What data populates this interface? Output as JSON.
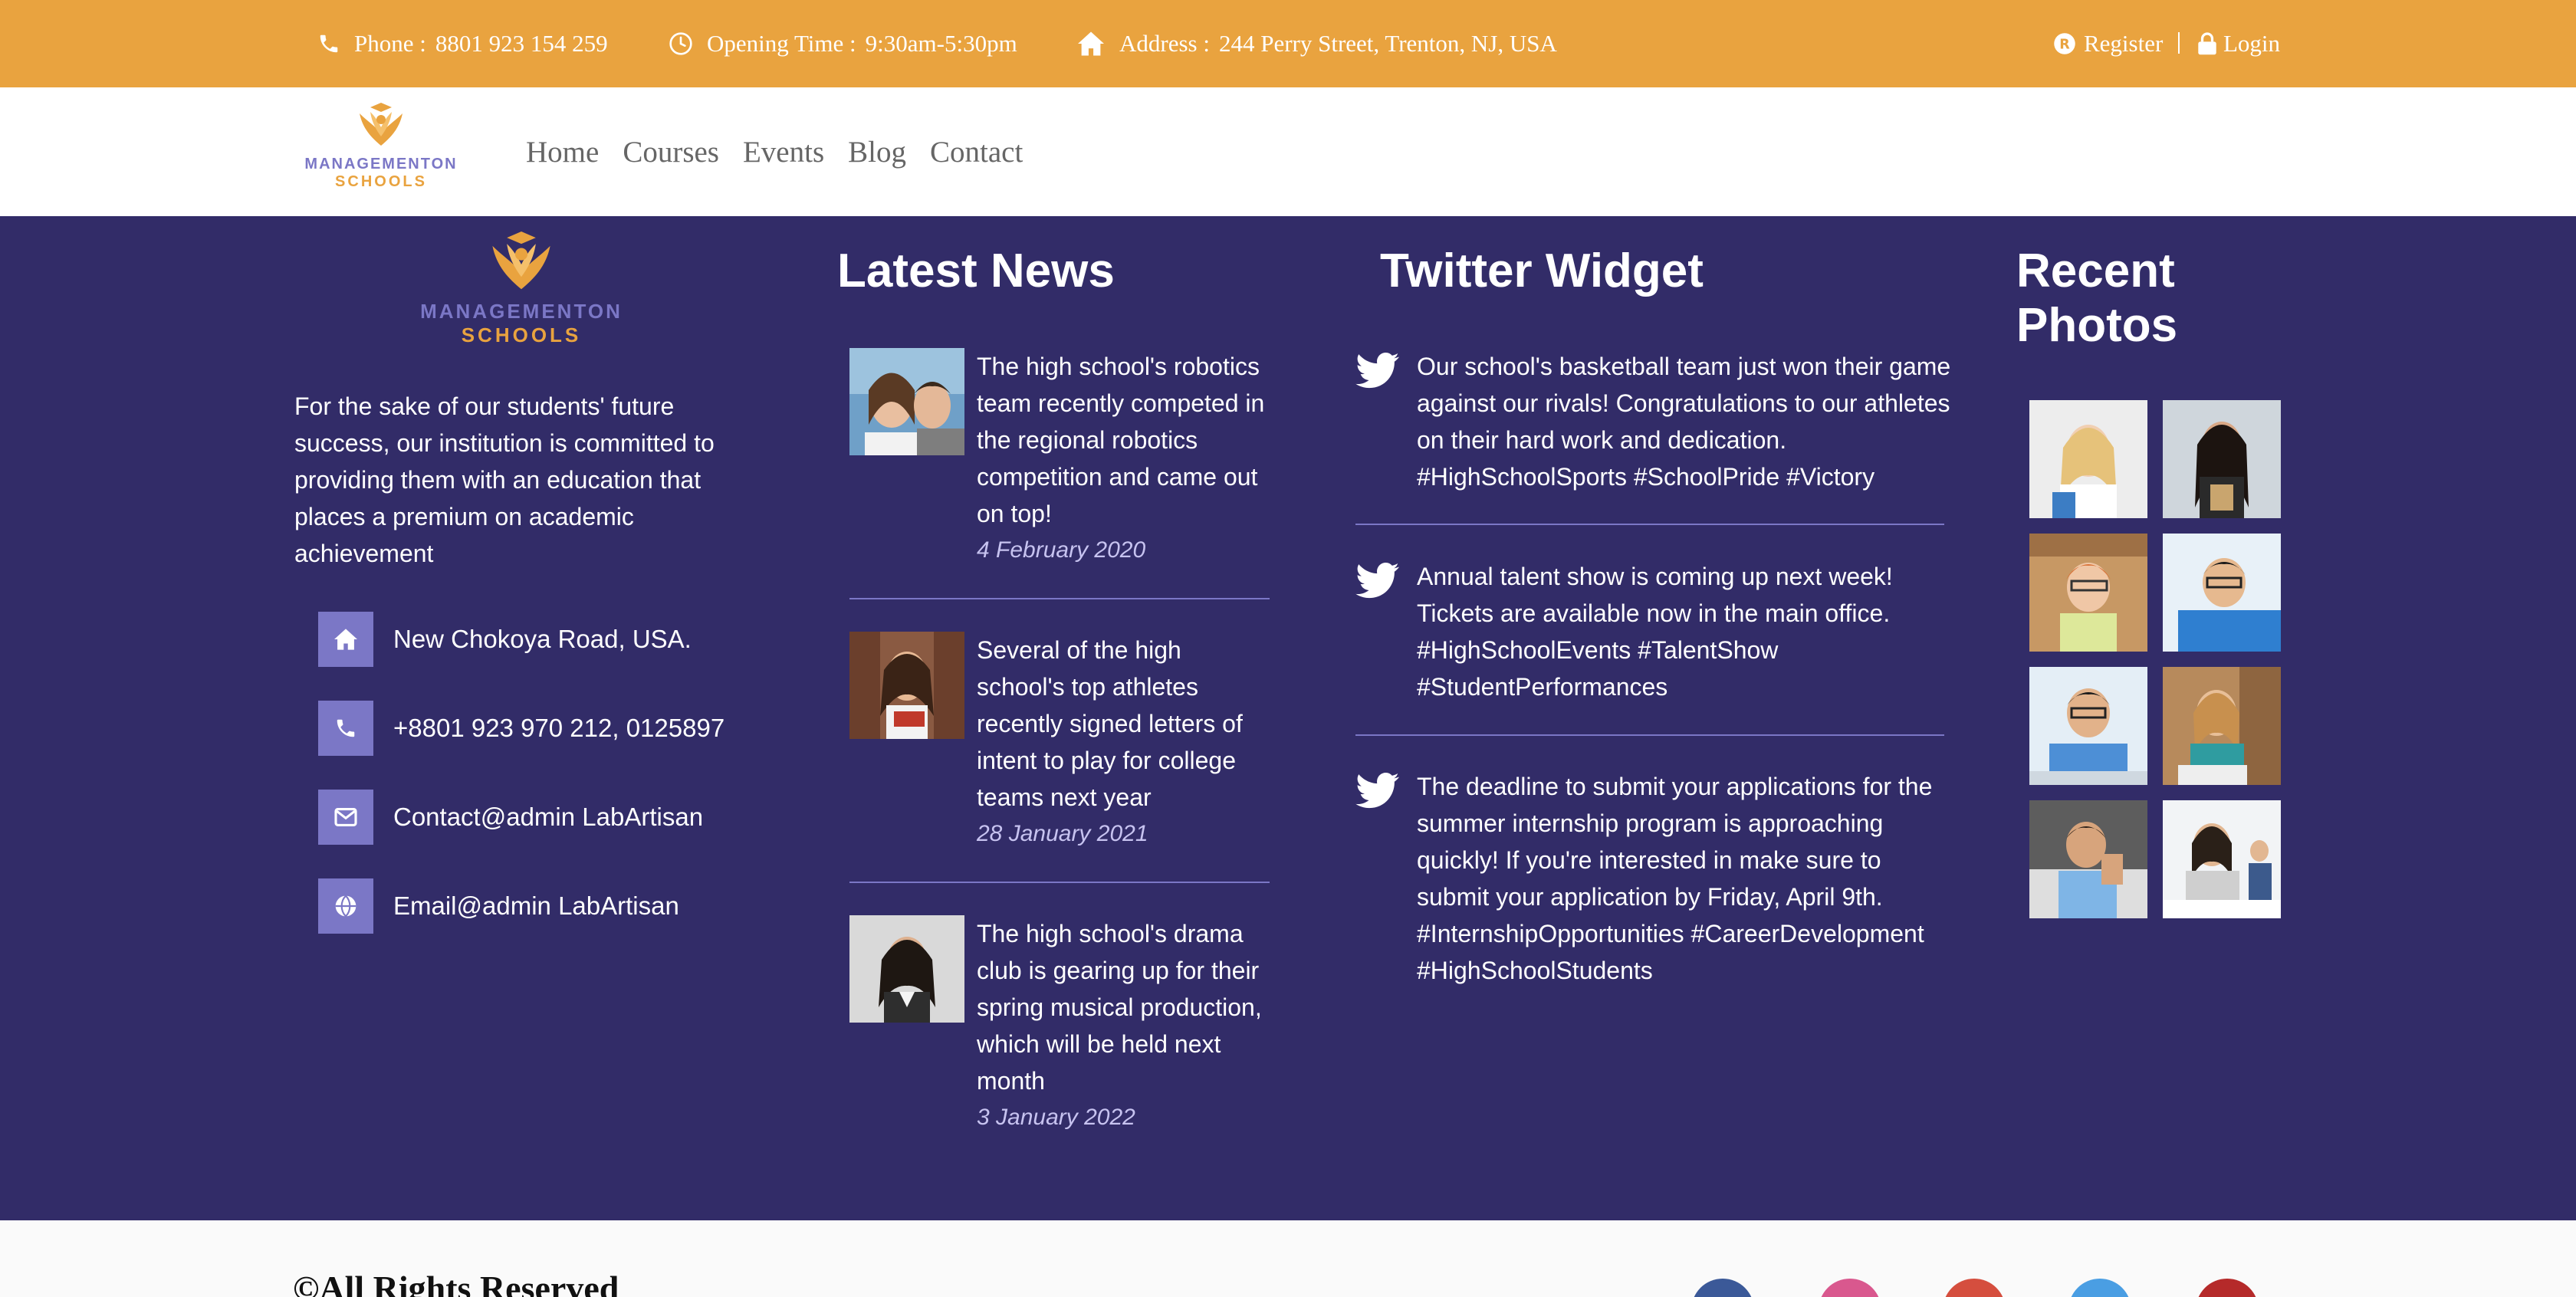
{
  "topbar": {
    "phone_label": "Phone :",
    "phone_value": "8801 923 154 259",
    "hours_label": "Opening Time :",
    "hours_value": "9:30am-5:30pm",
    "address_label": "Address :",
    "address_value": "244 Perry Street, Trenton, NJ, USA",
    "register": "Register",
    "login": "Login"
  },
  "brand": {
    "name_line1": "MANAGEMENTON",
    "name_line2": "SCHOOLS"
  },
  "nav": {
    "items": [
      "Home",
      "Courses",
      "Events",
      "Blog",
      "Contact"
    ]
  },
  "about": {
    "text": "For the sake of our students' future success, our institution is committed to providing them with an education that places a premium on academic achievement",
    "contacts": [
      {
        "icon": "home-icon",
        "text": "New Chokoya Road, USA."
      },
      {
        "icon": "phone-icon",
        "text": "+8801 923 970 212, 0125897"
      },
      {
        "icon": "envelope-icon",
        "text": "Contact@admin LabArtisan"
      },
      {
        "icon": "globe-icon",
        "text": "Email@admin LabArtisan"
      }
    ]
  },
  "news": {
    "title": "Latest News",
    "items": [
      {
        "text": "The high school's robotics team recently competed in the regional robotics competition and came out on top!",
        "date": "4 February 2020"
      },
      {
        "text": "Several of the high school's top athletes recently signed letters of intent to play for college teams next year",
        "date": "28 January 2021"
      },
      {
        "text": "The high school's drama club is gearing up for their spring musical production, which will be held next month",
        "date": "3 January 2022"
      }
    ]
  },
  "twitter": {
    "title": "Twitter Widget",
    "tweets": [
      "Our school's basketball team just won their game against our rivals! Congratulations to our athletes on their hard work and dedication. #HighSchoolSports #SchoolPride #Victory",
      "Annual talent show is coming up next week! Tickets are available now in the main office. #HighSchoolEvents #TalentShow #StudentPerformances",
      "The deadline to submit your applications for the summer internship program is approaching quickly! If you're interested in make sure to submit your application by Friday, April 9th. #InternshipOpportunities #CareerDevelopment #HighSchoolStudents"
    ]
  },
  "photos": {
    "title_line1": "Recent",
    "title_line2": "Photos",
    "count": 8
  },
  "footer_bottom": {
    "copyright": "©All Rights Reserved"
  },
  "colors": {
    "accent_orange": "#E9A33F",
    "footer_bg": "#322C68",
    "icon_purple": "#7B77C6",
    "social": [
      "#3B5998",
      "#D9588E",
      "#D54E3E",
      "#4A9EE3",
      "#B52A2A"
    ]
  }
}
